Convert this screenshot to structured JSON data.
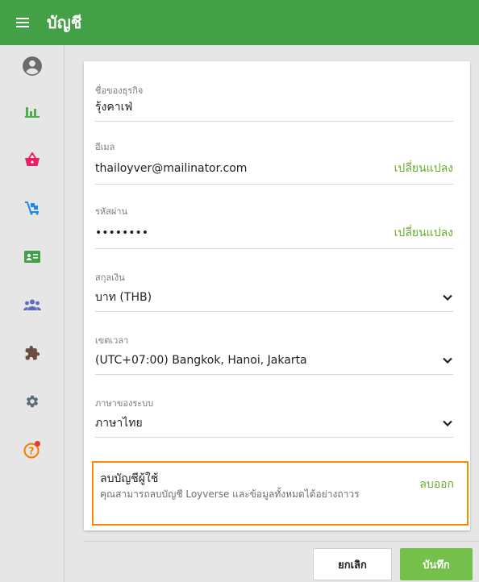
{
  "header": {
    "title": "บัญชี"
  },
  "sidebar": {
    "items": [
      {
        "icon": "account-circle-icon",
        "color": "#6a6a6a"
      },
      {
        "icon": "bar-chart-icon",
        "color": "#4caf50"
      },
      {
        "icon": "basket-icon",
        "color": "#e91e63"
      },
      {
        "icon": "items-cart-icon",
        "color": "#1e88e5"
      },
      {
        "icon": "id-card-icon",
        "color": "#43a047"
      },
      {
        "icon": "customers-icon",
        "color": "#5c6bc0"
      },
      {
        "icon": "puzzle-icon",
        "color": "#6d4c41"
      },
      {
        "icon": "gear-icon",
        "color": "#5a6b78"
      },
      {
        "icon": "help-icon",
        "color": "#f57c00",
        "badge_color": "#e53935"
      }
    ]
  },
  "form": {
    "business_name": {
      "label": "ชื่อของธุรกิจ",
      "value": "รุ้งคาเฟ่"
    },
    "email": {
      "label": "อีเมล",
      "value": "thailoyver@mailinator.com",
      "action": "เปลี่ยนแปลง"
    },
    "password": {
      "label": "รหัสผ่าน",
      "value": "••••••••",
      "action": "เปลี่ยนแปลง"
    },
    "currency": {
      "label": "สกุลเงิน",
      "value": "บาท (THB)"
    },
    "timezone": {
      "label": "เขตเวลา",
      "value": "(UTC+07:00) Bangkok, Hanoi, Jakarta"
    },
    "language": {
      "label": "ภาษาของระบบ",
      "value": "ภาษาไทย"
    }
  },
  "delete_account": {
    "title": "ลบบัญชีผู้ใช้",
    "description": "คุณสามารถลบบัญชี Loyverse และข้อมูลทั้งหมดได้อย่างถาวร",
    "button": "ลบออก",
    "highlight_color": "#ff8a00"
  },
  "footer": {
    "cancel": "ยกเลิก",
    "save": "บันทึก"
  },
  "colors": {
    "brand": "#43a047",
    "link": "#67ac2a",
    "save": "#74c04a"
  }
}
